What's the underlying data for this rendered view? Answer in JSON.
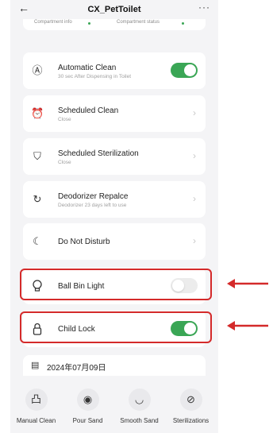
{
  "header": {
    "back_icon": "←",
    "title": "CX_PetToilet",
    "more_icon": "···",
    "sub_left": "Compartment info",
    "sub_right": "Compartment status"
  },
  "settings": [
    {
      "label": "Automatic Clean",
      "sub": "30 sec After Dispensing in Toilet",
      "icon": "auto-clean-icon",
      "glyph": "Ⓐ",
      "control": "toggle",
      "state": "on"
    },
    {
      "label": "Scheduled Clean",
      "sub": "Close",
      "icon": "alarm-clock-icon",
      "glyph": "⏰",
      "control": "chevron"
    },
    {
      "label": "Scheduled Sterilization",
      "sub": "Close",
      "icon": "shield-icon",
      "glyph": "⛉",
      "control": "chevron"
    },
    {
      "label": "Deodorizer Repalce",
      "sub": "Deodorizer 23 days left to use",
      "icon": "deodorizer-icon",
      "glyph": "↻",
      "control": "chevron"
    },
    {
      "label": "Do Not Disturb",
      "sub": "",
      "icon": "moon-icon",
      "glyph": "☾",
      "control": "chevron"
    },
    {
      "label": "Ball Bin Light",
      "sub": "",
      "icon": "lightbulb-icon",
      "glyph": "💡",
      "control": "toggle",
      "state": "off"
    },
    {
      "label": "Child Lock",
      "sub": "",
      "icon": "lock-icon",
      "glyph": "🔒",
      "control": "toggle",
      "state": "on"
    }
  ],
  "date_bar": {
    "icon": "calendar-icon",
    "glyph": "▤",
    "text": "2024年07月09日"
  },
  "actions": [
    {
      "label": "Manual Clean",
      "icon": "manual-clean-icon",
      "glyph": "凸"
    },
    {
      "label": "Pour Sand",
      "icon": "pour-sand-icon",
      "glyph": "◉"
    },
    {
      "label": "Smooth Sand",
      "icon": "smooth-sand-icon",
      "glyph": "◡"
    },
    {
      "label": "Sterilizations",
      "icon": "sterilization-icon",
      "glyph": "⊘"
    }
  ],
  "colors": {
    "accent": "#3aa655",
    "highlight": "#d42a2a",
    "background": "#f4f4f6"
  }
}
